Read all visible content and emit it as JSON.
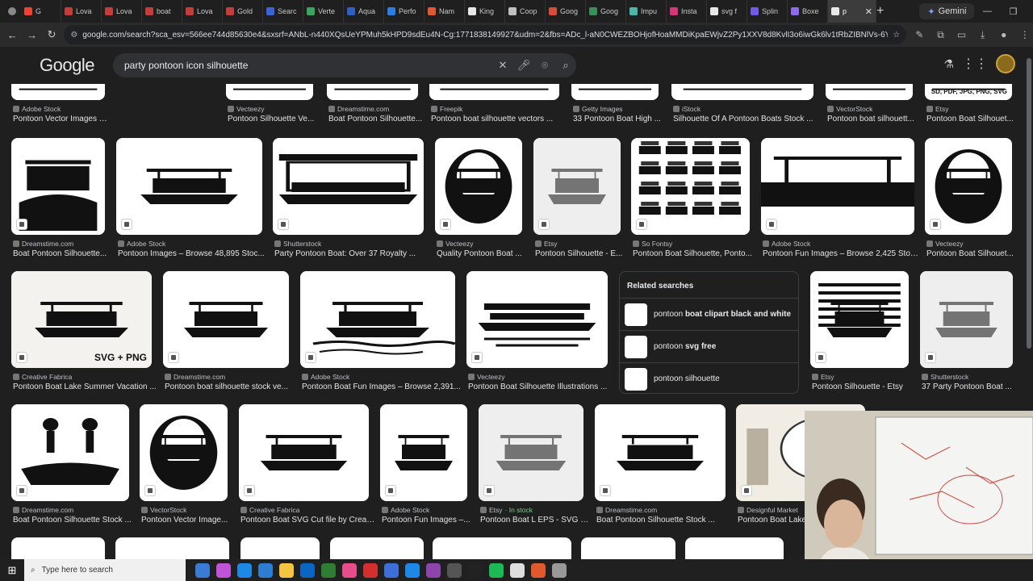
{
  "browser": {
    "tabs": [
      {
        "label": "G",
        "color": "#ea4335"
      },
      {
        "label": "Lova",
        "color": "#c43d3d"
      },
      {
        "label": "Lova",
        "color": "#c43d3d"
      },
      {
        "label": "boat",
        "color": "#c43d3d"
      },
      {
        "label": "Lova",
        "color": "#c43d3d"
      },
      {
        "label": "Gold",
        "color": "#c43d3d"
      },
      {
        "label": "Searc",
        "color": "#3b63d8"
      },
      {
        "label": "Verte",
        "color": "#3ba35a"
      },
      {
        "label": "Aqua",
        "color": "#2e5fc2"
      },
      {
        "label": "Perfo",
        "color": "#2a7de1"
      },
      {
        "label": "Nam",
        "color": "#e0582d"
      },
      {
        "label": "King",
        "color": "#e8e8e8"
      },
      {
        "label": "Coop",
        "color": "#bfbfbf"
      },
      {
        "label": "Goog",
        "color": "#d94c3a"
      },
      {
        "label": "Goog",
        "color": "#3a8e5a"
      },
      {
        "label": "Impu",
        "color": "#4db6ac"
      },
      {
        "label": "Insta",
        "color": "#d6367a"
      },
      {
        "label": "svg f",
        "color": "#e8e8e8"
      },
      {
        "label": "Splin",
        "color": "#6f5be8"
      },
      {
        "label": "Boxe",
        "color": "#8e6be8"
      },
      {
        "label": "p",
        "color": "#e8e8e8",
        "active": true
      }
    ],
    "gemini_tab": "Gemini",
    "url": "google.com/search?sca_esv=566ee744d85630e4&sxsrf=ANbL-n440XQsUeYPMuh5kHPD9sdEu4N-Cg:1771838149927&udm=2&fbs=ADc_l-aN0CWEZBOHjofHoaMMDiKpaEWjvZ2Py1XXV8d8KvlI3o6iwGk6lv1tRbZIBNlVs-6YKj3ieLLpE5n_AQ7k..."
  },
  "google": {
    "logo": "Google",
    "query": "party pontoon icon silhouette"
  },
  "rows": [
    [
      {
        "src": "Adobe Stock",
        "title": "Pontoon Vector Images – Browse 3,599 ..."
      },
      {
        "src": "Vecteezy",
        "title": "Pontoon Silhouette Ve..."
      },
      {
        "src": "Dreamstime.com",
        "title": "Boat Pontoon Silhouette..."
      },
      {
        "src": "Freepik",
        "title": "Pontoon boat silhouette vectors ..."
      },
      {
        "src": "Getty Images",
        "title": "33 Pontoon Boat High ..."
      },
      {
        "src": "iStock",
        "title": "Silhouette Of A Pontoon Boats Stock ..."
      },
      {
        "src": "VectorStock",
        "title": "Pontoon boat silhouett..."
      },
      {
        "src": "Etsy",
        "title": "Pontoon Boat Silhouet..."
      }
    ],
    [
      {
        "src": "Dreamstime.com",
        "title": "Boat Pontoon Silhouette..."
      },
      {
        "src": "Adobe Stock",
        "title": "Pontoon Images – Browse 48,895 Stoc..."
      },
      {
        "src": "Shutterstock",
        "title": "Party Pontoon Boat: Over 37 Royalty ..."
      },
      {
        "src": "Vecteezy",
        "title": "Quality Pontoon Boat ..."
      },
      {
        "src": "Etsy",
        "title": "Pontoon Silhouette - E..."
      },
      {
        "src": "So Fontsy",
        "title": "Pontoon Boat Silhouette, Ponto..."
      },
      {
        "src": "Adobe Stock",
        "title": "Pontoon Fun Images – Browse 2,425 Stoc..."
      },
      {
        "src": "Vecteezy",
        "title": "Pontoon Boat Silhouet..."
      }
    ],
    [
      {
        "src": "Creative Fabrica",
        "title": "Pontoon Boat Lake Summer Vacation ..."
      },
      {
        "src": "Dreamstime.com",
        "title": "Pontoon boat silhouette stock ve..."
      },
      {
        "src": "Adobe Stock",
        "title": "Pontoon Boat Fun Images – Browse 2,391..."
      },
      {
        "src": "Vecteezy",
        "title": "Pontoon Boat Silhouette Illustrations ..."
      },
      {
        "src": "Etsy",
        "title": "Pontoon Silhouette - Etsy"
      },
      {
        "src": "Shutterstock",
        "title": "37 Party Pontoon Boat ..."
      }
    ],
    [
      {
        "src": "Dreamstime.com",
        "title": "Boat Pontoon Silhouette Stock ..."
      },
      {
        "src": "VectorStock",
        "title": "Pontoon Vector Image..."
      },
      {
        "src": "Creative Fabrica",
        "title": "Pontoon Boat SVG Cut file by Creat..."
      },
      {
        "src": "Adobe Stock",
        "title": "Pontoon Fun Images –..."
      },
      {
        "src": "Etsy",
        "stock": "· In stock",
        "title": "Pontoon Boat L EPS - SVG - ..."
      },
      {
        "src": "Dreamstime.com",
        "title": "Boat Pontoon Silhouette Stock ..."
      },
      {
        "src": "Designful Market",
        "title": "Pontoon Boat Lake"
      }
    ]
  ],
  "image_texts": {
    "svg_png": "SVG + PNG",
    "sd_pdf": "SD, PDF, JPG, PNG, SVG",
    "slow": "SLOW P",
    "svg_png2": "SVG + PN"
  },
  "related": {
    "heading": "Related searches",
    "items": [
      {
        "pre": "pontoon ",
        "bold": "boat clipart black and white"
      },
      {
        "pre": "pontoon ",
        "bold": "svg free"
      },
      {
        "pre": "pontoon silhouette",
        "bold": ""
      }
    ]
  },
  "taskbar": {
    "search_placeholder": "Type here to search"
  }
}
